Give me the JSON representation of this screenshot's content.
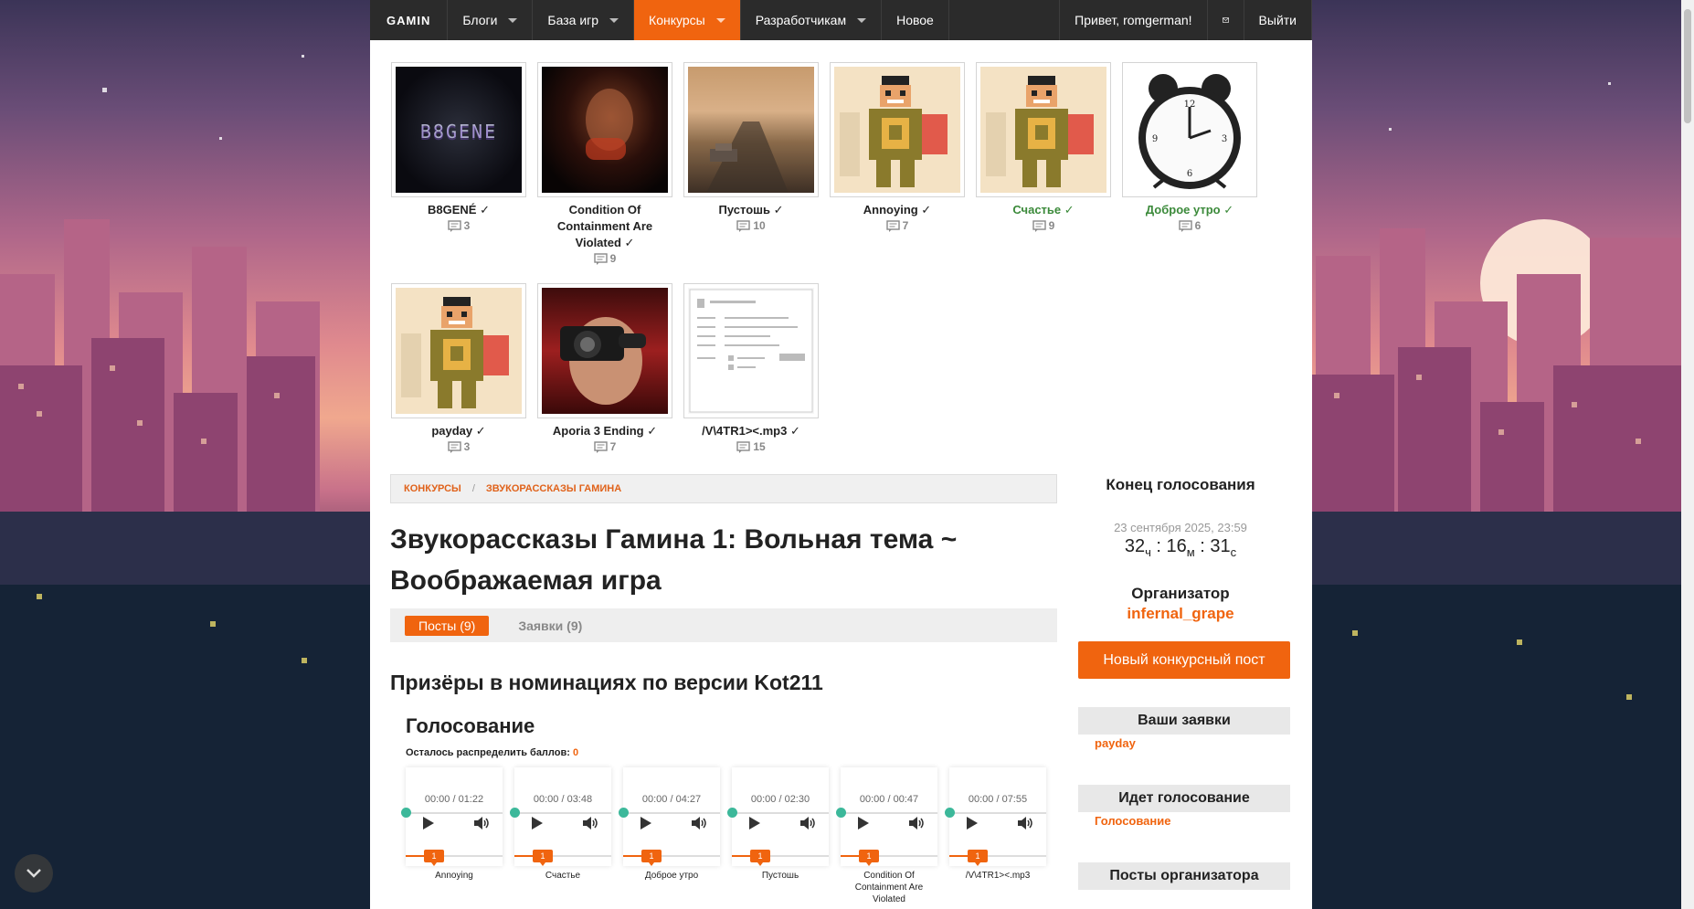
{
  "nav": {
    "logo": "GAMIN",
    "items": [
      {
        "label": "Блоги",
        "has_caret": true
      },
      {
        "label": "База игр",
        "has_caret": true
      },
      {
        "label": "Конкурсы",
        "has_caret": true,
        "active": true
      },
      {
        "label": "Разработчикам",
        "has_caret": true
      },
      {
        "label": "Новое",
        "has_caret": false
      }
    ],
    "greeting": "Привет, romgerman!",
    "logout": "Выйти"
  },
  "entries": [
    {
      "title": "B8GENÉ ✓",
      "comments": "3",
      "image": "bugene",
      "green": false
    },
    {
      "title": "Condition Of Containment Are Violated ✓",
      "comments": "9",
      "image": "condition",
      "green": false
    },
    {
      "title": "Пустошь ✓",
      "comments": "10",
      "image": "road",
      "green": false
    },
    {
      "title": "Annoying ✓",
      "comments": "7",
      "image": "pixel",
      "green": false
    },
    {
      "title": "Счастье ✓",
      "comments": "9",
      "image": "pixel",
      "green": true
    },
    {
      "title": "Доброе утро ✓",
      "comments": "6",
      "image": "clock",
      "green": true
    },
    {
      "title": "payday ✓",
      "comments": "3",
      "image": "pixel",
      "green": false
    },
    {
      "title": "Aporia 3 Ending ✓",
      "comments": "7",
      "image": "aporia",
      "green": false
    },
    {
      "title": "/V\\4TR1><.mp3 ✓",
      "comments": "15",
      "image": "shot",
      "green": false
    }
  ],
  "breadcrumb": {
    "item1": "Конкурсы",
    "separator": "/",
    "item2": "Звукорассказы Гамина"
  },
  "page_title": "Звукорассказы Гамина 1: Вольная тема ~ Воображаемая игра",
  "tabs": {
    "posts": "Посты (9)",
    "applications": "Заявки (9)"
  },
  "prize_heading": "Призёры в номинациях по версии Kot211",
  "vote_heading": "Голосование",
  "points": {
    "label": "Осталось распределить баллов:",
    "value": "0"
  },
  "players": [
    {
      "time": "00:00 / 01:22",
      "name": "Annoying",
      "points": "1"
    },
    {
      "time": "00:00 / 03:48",
      "name": "Счастье",
      "points": "1"
    },
    {
      "time": "00:00 / 04:27",
      "name": "Доброе утро",
      "points": "1"
    },
    {
      "time": "00:00 / 02:30",
      "name": "Пустошь",
      "points": "1"
    },
    {
      "time": "00:00 / 00:47",
      "name": "Condition Of Containment Are Violated",
      "points": "1"
    },
    {
      "time": "00:00 / 07:55",
      "name": "/V\\4TR1><.mp3",
      "points": "1"
    }
  ],
  "sidebar": {
    "vote_end_heading": "Конец голосования",
    "end_date": "23 сентября 2025, 23:59",
    "countdown": {
      "hours": "32",
      "h_unit": "ч",
      "minutes": "16",
      "m_unit": "м",
      "seconds": "31",
      "s_unit": "с",
      "sep": ":"
    },
    "organizer_heading": "Организатор",
    "organizer_name": "infernal_grape",
    "new_post_button": "Новый конкурсный пост",
    "your_apps_heading": "Ваши заявки",
    "your_app_link": "payday",
    "voting_heading": "Идет голосование",
    "voting_link": "Голосование",
    "organizer_posts_heading": "Посты организатора"
  },
  "colors": {
    "accent": "#f0640f",
    "nav_bg": "#2b2b2b",
    "progress_dot": "#3cb89a",
    "green_title": "#3b8a3a"
  }
}
